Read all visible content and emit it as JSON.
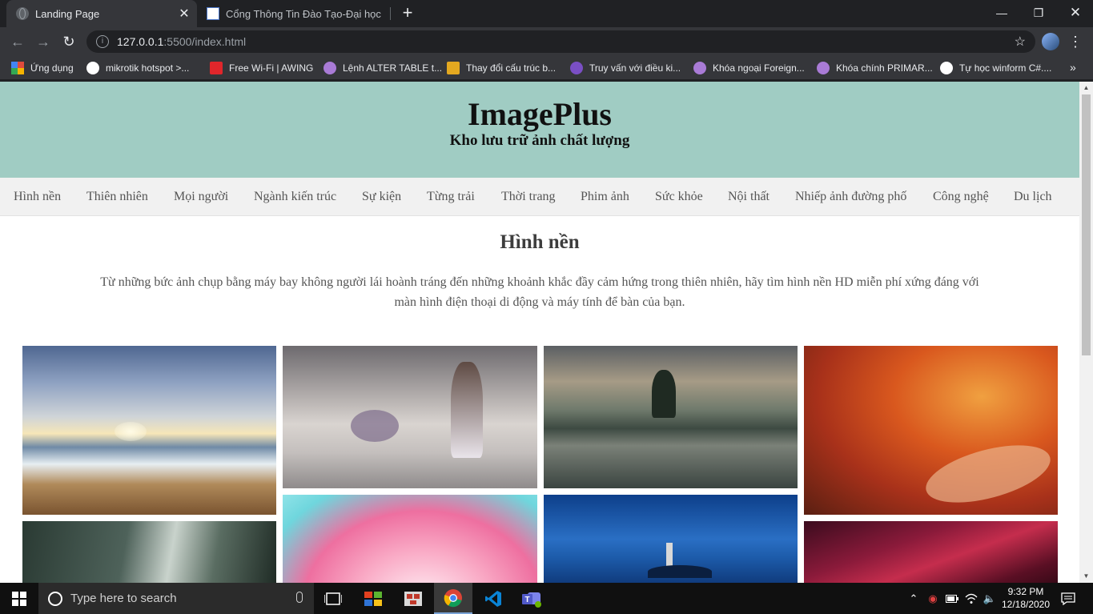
{
  "browser": {
    "tabs": [
      {
        "title": "Landing Page",
        "active": true
      },
      {
        "title": "Cổng Thông Tin Đào Tạo-Đại học",
        "active": false
      }
    ],
    "url_host": "127.0.0.1",
    "url_rest": ":5500/index.html",
    "bookmarks": [
      {
        "label": "Ứng dụng",
        "color": "#e04b3c"
      },
      {
        "label": "mikrotik hotspot >...",
        "color": "#ffffff"
      },
      {
        "label": "Free Wi-Fi | AWING",
        "color": "#e0262b"
      },
      {
        "label": "Lệnh ALTER TABLE t...",
        "color": "#a97bd6"
      },
      {
        "label": "Thay đổi cấu trúc b...",
        "color": "#e3a820"
      },
      {
        "label": "Truy vấn với điều ki...",
        "color": "#7a4fc4"
      },
      {
        "label": "Khóa ngoại Foreign...",
        "color": "#a97bd6"
      },
      {
        "label": "Khóa chính PRIMAR...",
        "color": "#a97bd6"
      },
      {
        "label": "Tự học winform C#....",
        "color": "#ffffff"
      }
    ]
  },
  "page": {
    "site_title": "ImagePlus",
    "site_tagline": "Kho lưu trữ ảnh chất lượng",
    "nav": [
      "Hình nền",
      "Thiên nhiên",
      "Mọi người",
      "Ngành kiến trúc",
      "Sự kiện",
      "Từng trải",
      "Thời trang",
      "Phim ảnh",
      "Sức khỏe",
      "Nội thất",
      "Nhiếp ảnh đường phố",
      "Công nghệ",
      "Du lịch"
    ],
    "section_title": "Hình nền",
    "section_desc": "Từ những bức ảnh chụp bằng máy bay không người lái hoành tráng đến những khoảnh khắc đầy cảm hứng trong thiên nhiên, hãy tìm hình nền HD miễn phí xứng đáng với màn hình điện thoại di động và máy tính để bàn của bạn.",
    "photos": [
      {
        "name": "photo-beach-sunset",
        "icon": "beach-sunset-image"
      },
      {
        "name": "photo-woman-clouds",
        "icon": "fantasy-clouds-image"
      },
      {
        "name": "photo-lake-island",
        "icon": "lake-island-image"
      },
      {
        "name": "photo-autumn-forest",
        "icon": "autumn-forest-image"
      },
      {
        "name": "photo-misty-forest",
        "icon": "misty-forest-image"
      },
      {
        "name": "photo-pink-flower",
        "icon": "pink-flower-image"
      },
      {
        "name": "photo-lighthouse",
        "icon": "lighthouse-image"
      },
      {
        "name": "photo-red-abstract",
        "icon": "red-abstract-image"
      }
    ]
  },
  "taskbar": {
    "search_placeholder": "Type here to search",
    "time": "9:32 PM",
    "date": "12/18/2020"
  }
}
